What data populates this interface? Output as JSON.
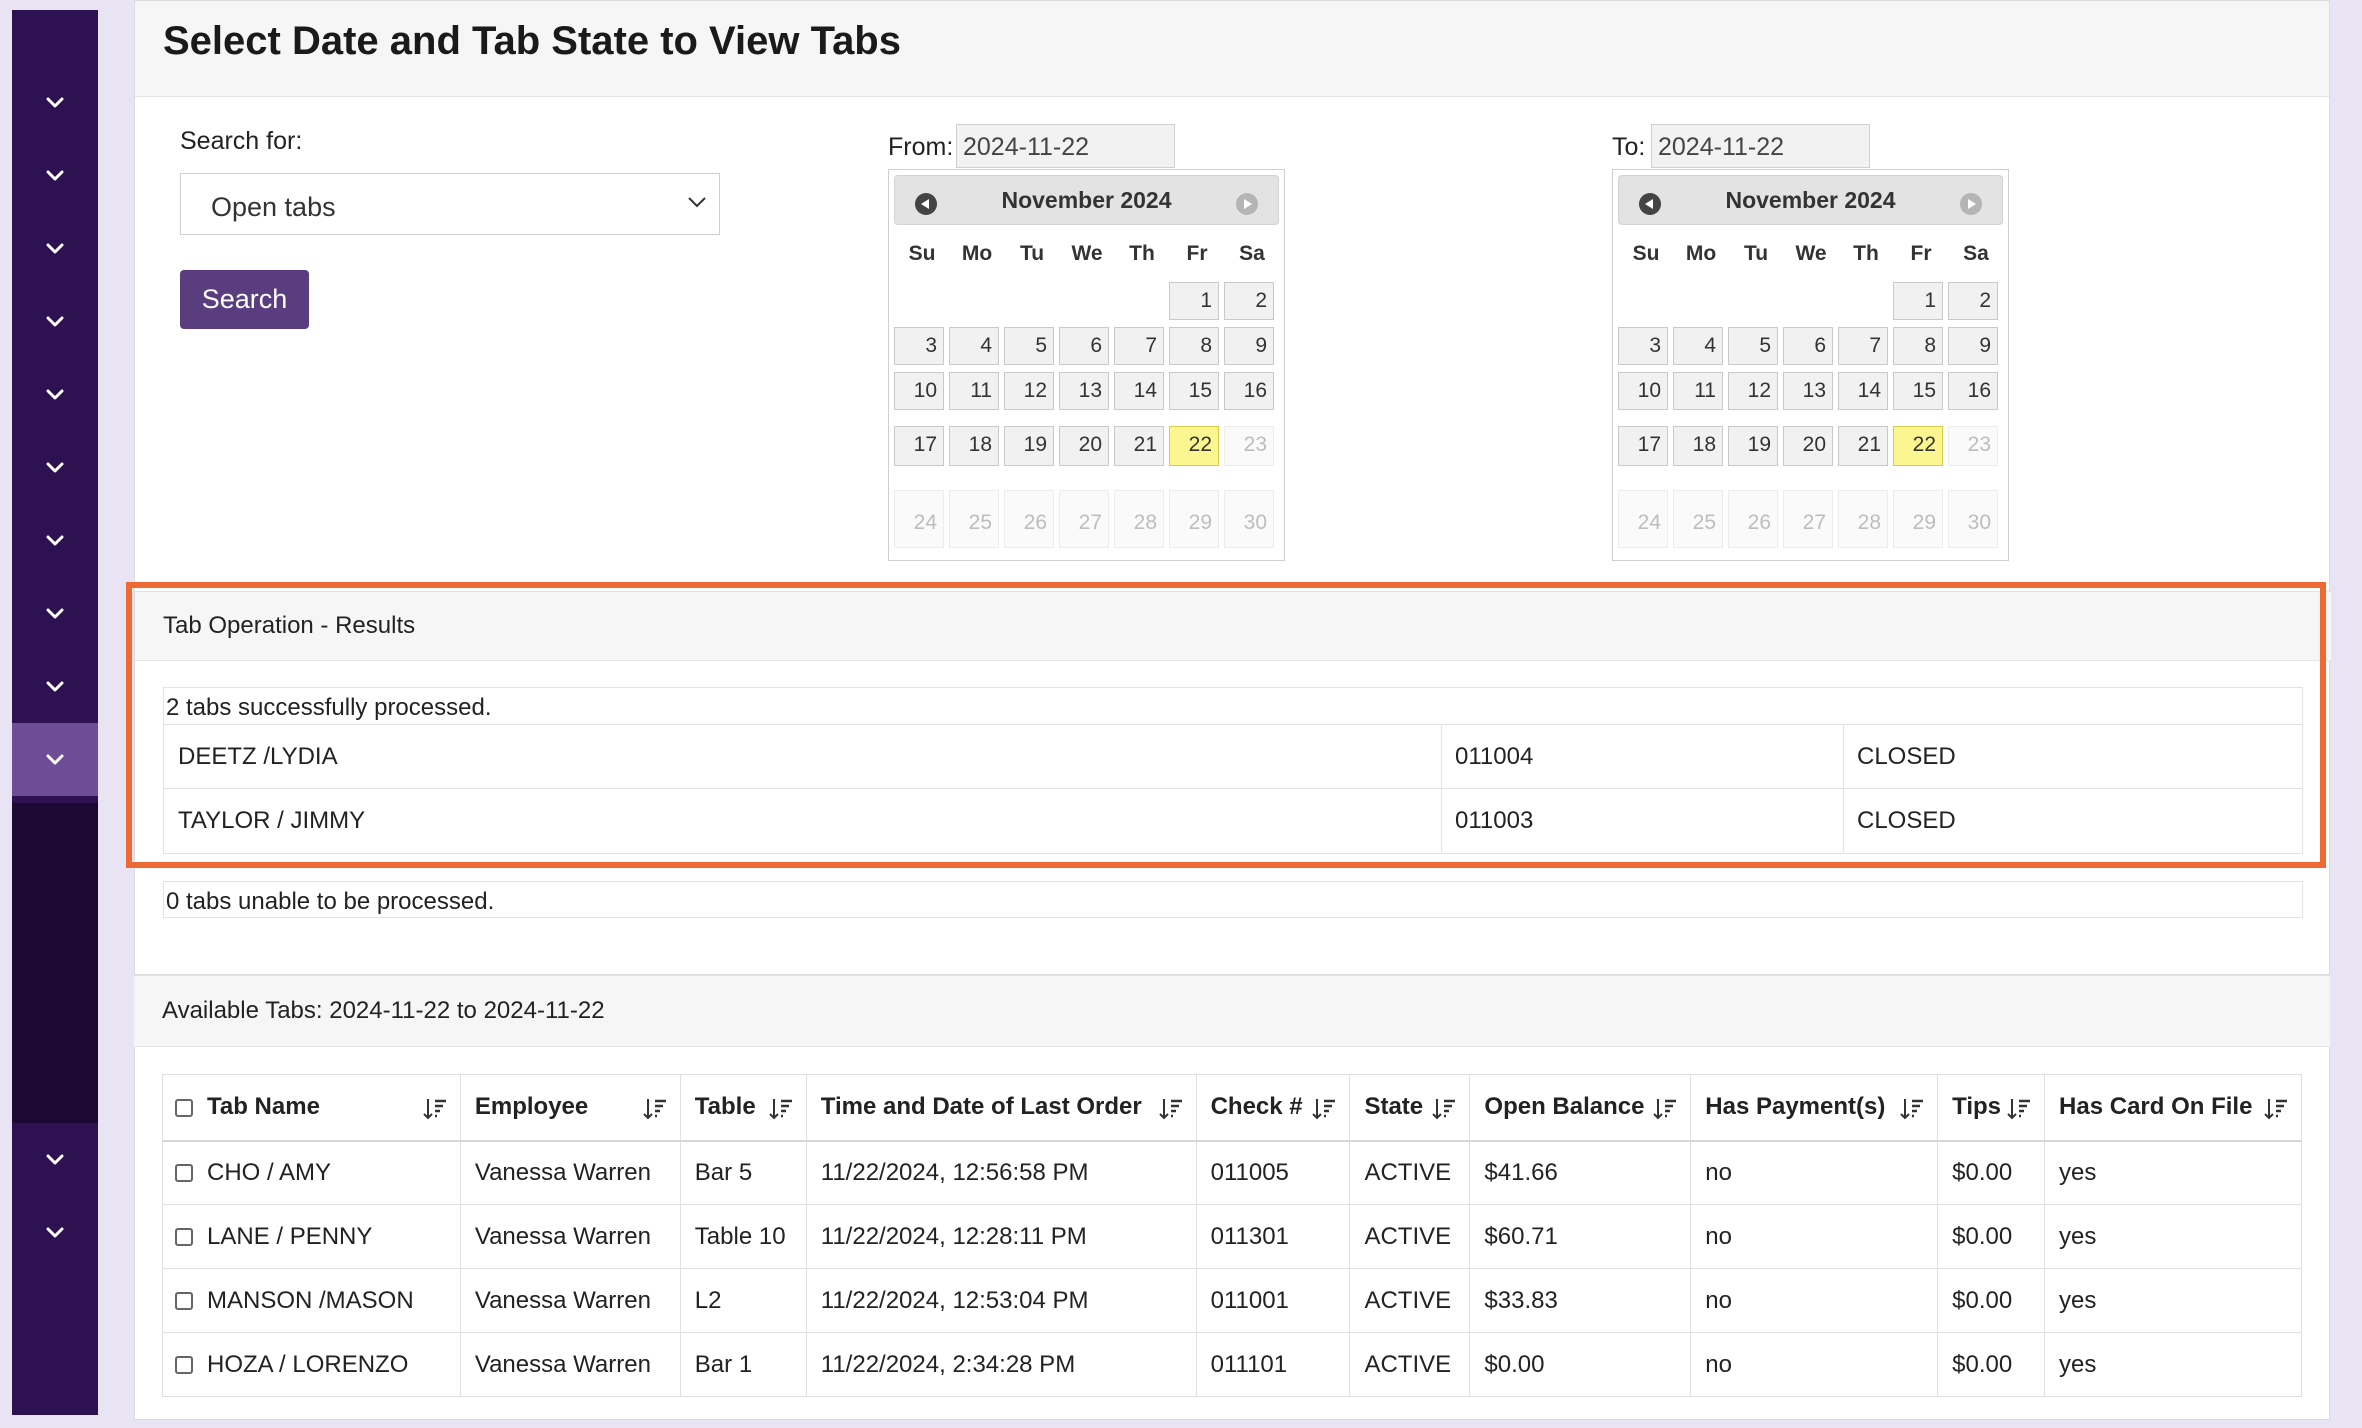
{
  "header": {
    "title": "Select Date and Tab State to View Tabs"
  },
  "search": {
    "label": "Search for:",
    "selected": "Open tabs",
    "button": "Search"
  },
  "from": {
    "label": "From:",
    "value": "2024-11-22"
  },
  "to": {
    "label": "To:",
    "value": "2024-11-22"
  },
  "calendar": {
    "month": "November 2024",
    "weekdays": [
      "Su",
      "Mo",
      "Tu",
      "We",
      "Th",
      "Fr",
      "Sa"
    ],
    "selected_day": 22
  },
  "results": {
    "title": "Tab Operation - Results",
    "success_caption": "2 tabs successfully processed.",
    "processed": [
      {
        "name": "DEETZ /LYDIA",
        "check": "011004",
        "state": "CLOSED"
      },
      {
        "name": "TAYLOR / JIMMY",
        "check": "011003",
        "state": "CLOSED"
      }
    ],
    "fail_caption": "0 tabs unable to be processed."
  },
  "available": {
    "title": "Available Tabs: 2024-11-22 to 2024-11-22",
    "columns": [
      "Tab Name",
      "Employee",
      "Table",
      "Time and Date of Last Order",
      "Check #",
      "State",
      "Open Balance",
      "Has Payment(s)",
      "Tips",
      "Has Card On File"
    ],
    "rows": [
      [
        "CHO / AMY",
        "Vanessa Warren",
        "Bar 5",
        "11/22/2024, 12:56:58 PM",
        "011005",
        "ACTIVE",
        "$41.66",
        "no",
        "$0.00",
        "yes"
      ],
      [
        "LANE / PENNY",
        "Vanessa Warren",
        "Table 10",
        "11/22/2024, 12:28:11 PM",
        "011301",
        "ACTIVE",
        "$60.71",
        "no",
        "$0.00",
        "yes"
      ],
      [
        "MANSON /MASON",
        "Vanessa Warren",
        "L2",
        "11/22/2024, 12:53:04 PM",
        "011001",
        "ACTIVE",
        "$33.83",
        "no",
        "$0.00",
        "yes"
      ],
      [
        "HOZA / LORENZO",
        "Vanessa Warren",
        "Bar 1",
        "11/22/2024, 2:34:28 PM",
        "011101",
        "ACTIVE",
        "$0.00",
        "no",
        "$0.00",
        "yes"
      ]
    ]
  },
  "colors": {
    "sidebar": "#2d1150",
    "sidebar_active": "#6f4c96",
    "button": "#5a3d7e",
    "highlight": "#ee6a35",
    "today": "#fbf68f"
  }
}
